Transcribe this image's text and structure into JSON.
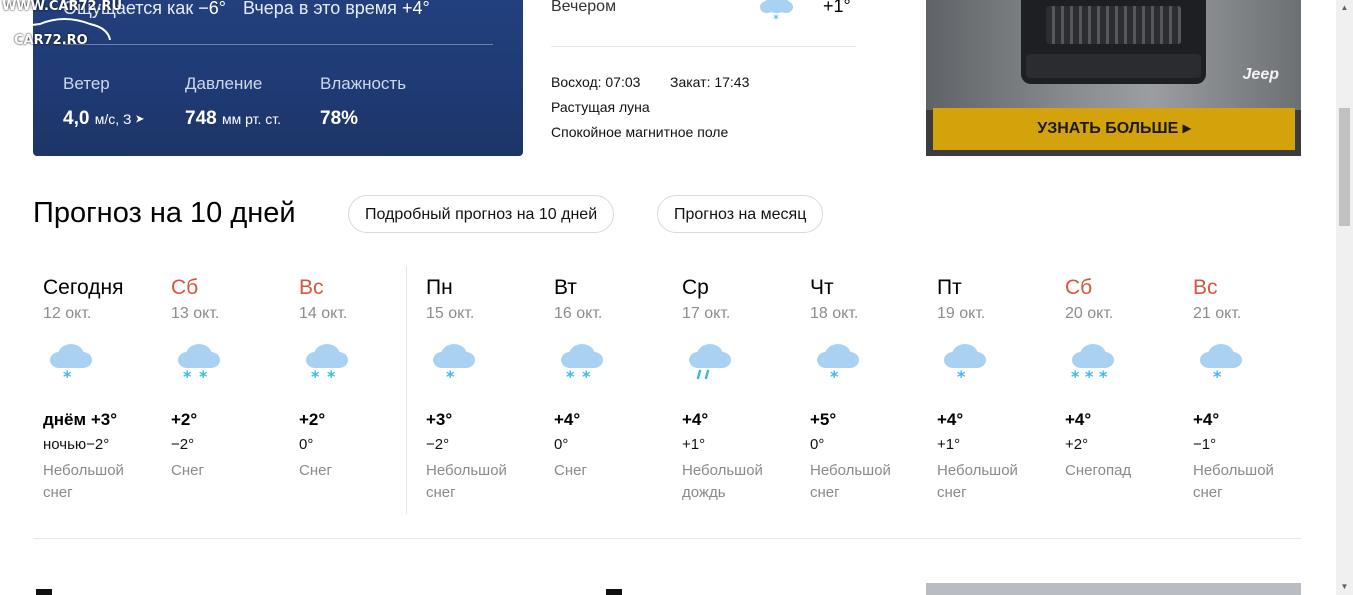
{
  "now": {
    "feels_label": "Ощущается как",
    "feels_value": "−6°",
    "yesterday_label": "Вчера в это время",
    "yesterday_value": "+4°",
    "wind": {
      "label": "Ветер",
      "value": "4,0",
      "unit": "м/с, З"
    },
    "pressure": {
      "label": "Давление",
      "value": "748",
      "unit": "мм рт. ст."
    },
    "humidity": {
      "label": "Влажность",
      "value": "78%"
    }
  },
  "watermark": {
    "url": "WWW.CAR72.RU",
    "name": "CAR72.RO"
  },
  "mid": {
    "evening_label": "Вечером",
    "evening_temp": "+1°",
    "evening_icon": "snow-cloud-icon",
    "sunrise": "Восход: 07:03",
    "sunset": "Закат: 17:43",
    "moon": "Растущая луна",
    "magnetic": "Спокойное магнитное поле"
  },
  "ad": {
    "brand": "Jeep",
    "cta": "УЗНАТЬ БОЛЬШЕ ▸"
  },
  "forecast": {
    "title": "Прогноз на 10 дней",
    "link_detailed": "Подробный прогноз на 10 дней",
    "link_month": "Прогноз на месяц",
    "days": [
      {
        "name": "Сегодня",
        "date": "12 окт.",
        "day": "днём +3°",
        "night": "ночью−2°",
        "cond": "Небольшой снег",
        "icon": "light-snow-icon",
        "weekend": false
      },
      {
        "name": "Сб",
        "date": "13 окт.",
        "day": "+2°",
        "night": "−2°",
        "cond": "Снег",
        "icon": "snow-icon",
        "weekend": true
      },
      {
        "name": "Вс",
        "date": "14 окт.",
        "day": "+2°",
        "night": "0°",
        "cond": "Снег",
        "icon": "snow-icon",
        "weekend": true
      },
      {
        "name": "Пн",
        "date": "15 окт.",
        "day": "+3°",
        "night": "−2°",
        "cond": "Небольшой снег",
        "icon": "light-snow-icon",
        "weekend": false
      },
      {
        "name": "Вт",
        "date": "16 окт.",
        "day": "+4°",
        "night": "0°",
        "cond": "Снег",
        "icon": "snow-icon",
        "weekend": false
      },
      {
        "name": "Ср",
        "date": "17 окт.",
        "day": "+4°",
        "night": "+1°",
        "cond": "Небольшой дождь",
        "icon": "light-rain-icon",
        "weekend": false
      },
      {
        "name": "Чт",
        "date": "18 окт.",
        "day": "+5°",
        "night": "0°",
        "cond": "Небольшой снег",
        "icon": "light-snow-icon",
        "weekend": false
      },
      {
        "name": "Пт",
        "date": "19 окт.",
        "day": "+4°",
        "night": "+1°",
        "cond": "Небольшой снег",
        "icon": "light-snow-icon",
        "weekend": false
      },
      {
        "name": "Сб",
        "date": "20 окт.",
        "day": "+4°",
        "night": "+2°",
        "cond": "Снегопад",
        "icon": "heavy-snow-icon",
        "weekend": true
      },
      {
        "name": "Вс",
        "date": "21 окт.",
        "day": "+4°",
        "night": "−1°",
        "cond": "Небольшой снег",
        "icon": "light-snow-icon",
        "weekend": true
      }
    ]
  },
  "colors": {
    "weekend": "#d9563e",
    "card": "#1f3a73",
    "cta": "#d4a20b",
    "snow": "#41b6e6",
    "cloud": "#a9d1f2"
  }
}
